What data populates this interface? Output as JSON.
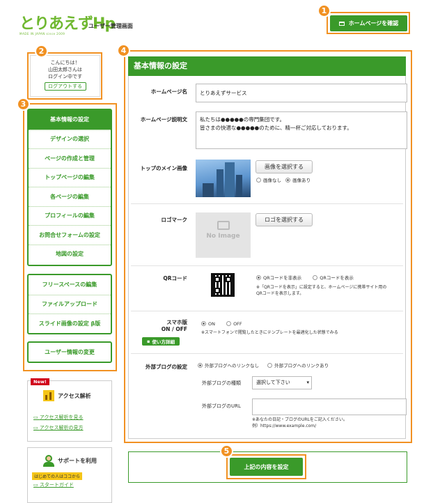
{
  "header": {
    "logo_text": "とりあえずHp",
    "logo_sub": "MADE IN JAPAN since 2009",
    "admin_title": "ユーザー管理画面",
    "view_homepage_button": "ホームページを確認"
  },
  "callouts": [
    "1",
    "2",
    "3",
    "4",
    "5"
  ],
  "greeting": {
    "line1": "こんにちは！",
    "line2": "山田太郎さんは",
    "line3": "ログイン中です",
    "logout_button": "ログアウトする"
  },
  "menu": {
    "group1": [
      "基本情報の設定",
      "デザインの選択",
      "ページの作成と管理",
      "トップページの編集",
      "各ページの編集",
      "プロフィールの編集",
      "お問合せフォームの設定",
      "地図の設定"
    ],
    "group2": [
      "フリースペースの編集",
      "ファイルアップロード",
      "スライド画像の設定 β版"
    ],
    "group3": [
      "ユーザー情報の変更"
    ]
  },
  "access": {
    "badge": "New!",
    "title": "アクセス解析",
    "link1": "アクセス解析を見る",
    "link2": "アクセス解析の見方"
  },
  "support": {
    "title": "サポートを利用",
    "badge": "はじめての人はココから",
    "link1": "スタートガイド"
  },
  "panel": {
    "title": "基本情報の設定",
    "homepage_name_label": "ホームページ名",
    "homepage_name_value": "とりあえずサービス",
    "description_label": "ホームページ説明文",
    "description_line1": "私たちは●●●●●の専門集団です。",
    "description_line2": "皆さまの快適な●●●●●のために、精一杯ご対応しております。",
    "main_image_label": "トップのメイン画像",
    "select_image_button": "画像を選択する",
    "image_none": "画像なし",
    "image_yes": "画像あり",
    "logo_label": "ロゴマーク",
    "no_image": "No Image",
    "select_logo_button": "ロゴを選択する",
    "qr_label": "QRコード",
    "qr_hide": "QRコードを非表示",
    "qr_show": "QRコードを表示",
    "qr_note_line1": "※「QRコードを表示」に設定すると、ホームページに携帯サイト用の",
    "qr_note_line2": "QRコードを表示します。",
    "smartphone_label_line1": "スマホ版",
    "smartphone_label_line2": "ON / OFF",
    "usage_button": "使い方詳細",
    "smartphone_on": "ON",
    "smartphone_off": "OFF",
    "smartphone_note": "※スマートフォンで閲覧したときにテンプレートを最適化した状態でみる",
    "blog_label": "外部ブログの設定",
    "blog_no_link": "外部ブログへのリンクなし",
    "blog_link": "外部ブログへのリンクあり",
    "blog_type_label": "外部ブログの種類",
    "blog_type_value": "選択して下さい",
    "blog_url_label": "外部ブログのURL",
    "blog_url_note_line1": "※あなたの日記・ブログのURLをご記入ください。",
    "blog_url_note_line2": "例）https://www.example.com/"
  },
  "submit_button": "上記の内容を設定",
  "colors": {
    "brand_green": "#3a9a2a",
    "callout_orange": "#f19122"
  }
}
